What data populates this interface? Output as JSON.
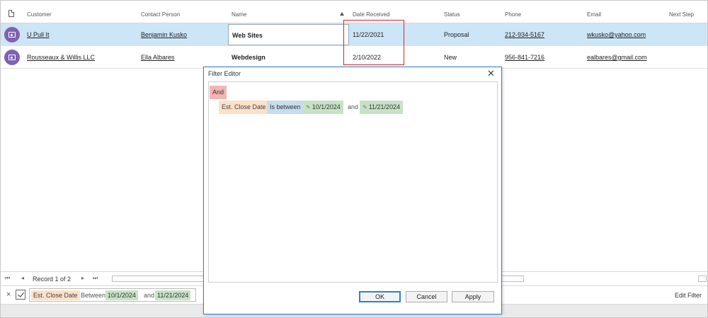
{
  "columns": {
    "customer": "Customer",
    "contact": "Contact Person",
    "name": "Name",
    "date_received": "Date Received",
    "status": "Status",
    "phone": "Phone",
    "email": "Email",
    "next_step": "Next Step"
  },
  "rows": [
    {
      "customer": "U Pull It",
      "contact": "Benjamin Kusko",
      "name": "Web Sites",
      "date_received": "11/22/2021",
      "status": "Proposal",
      "phone": "212-934-5167",
      "email": "wkusko@yahoo.com"
    },
    {
      "customer": "Rousseaux & Willis LLC",
      "contact": "Ella Albares",
      "name": "Webdesign",
      "date_received": "2/10/2022",
      "status": "New",
      "phone": "956-841-7216",
      "email": "ealbares@gmail.com"
    }
  ],
  "pager": {
    "first": "⏮",
    "prev": "◂",
    "record_text": "Record 1 of 2",
    "next": "▸",
    "last": "⏭"
  },
  "filter_panel": {
    "clear": "×",
    "field": "Est. Close Date",
    "operator": "Between",
    "value1": "10/1/2024",
    "conjunction": "and",
    "value2": "11/21/2024",
    "edit_filter": "Edit Filter"
  },
  "filter_editor": {
    "title": "Filter Editor",
    "close": "✕",
    "group": "And",
    "field": "Est. Close Date",
    "operator": "Is between",
    "value1": "10/1/2024",
    "conjunction": "and",
    "value2": "11/21/2024",
    "ok": "OK",
    "cancel": "Cancel",
    "apply": "Apply"
  },
  "icons": {
    "header": "document-icon",
    "row_avatar": "camera-icon",
    "value_edit": "pencil-icon"
  },
  "colors": {
    "selected_row": "#cde6f7",
    "avatar": "#8062b4",
    "and_tag": "#f4b4b4",
    "field_tag": "#fde0c8",
    "operator_tag": "#c6dcef",
    "value_tag": "#c8e2c6",
    "annotation": "#e02020",
    "dialog_border": "#2f7fd0"
  }
}
